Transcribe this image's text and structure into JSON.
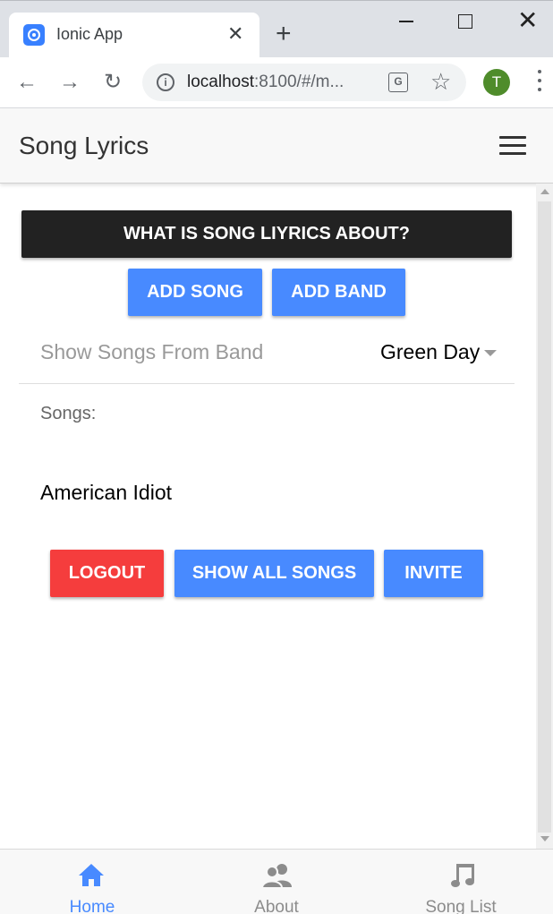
{
  "browser": {
    "tab_title": "Ionic App",
    "url_host": "localhost",
    "url_rest": ":8100/#/m...",
    "profile_initial": "T"
  },
  "header": {
    "title": "Song Lyrics"
  },
  "main": {
    "about_button": "WHAT IS SONG LIYRICS ABOUT?",
    "add_song_button": "ADD SONG",
    "add_band_button": "ADD BAND",
    "band_select": {
      "label": "Show Songs From Band",
      "value": "Green Day"
    },
    "songs_label": "Songs:",
    "songs": [
      "American Idiot"
    ],
    "logout_button": "LOGOUT",
    "show_all_button": "SHOW ALL SONGS",
    "invite_button": "INVITE"
  },
  "tabs": [
    {
      "label": "Home",
      "icon": "home-icon",
      "active": true
    },
    {
      "label": "About",
      "icon": "contacts-icon",
      "active": false
    },
    {
      "label": "Song List",
      "icon": "musical-note-icon",
      "active": false
    }
  ],
  "colors": {
    "primary": "#488aff",
    "danger": "#f53d3d",
    "dark": "#222222",
    "tab_active": "#488aff",
    "tab_inactive": "#8c8c8c"
  }
}
